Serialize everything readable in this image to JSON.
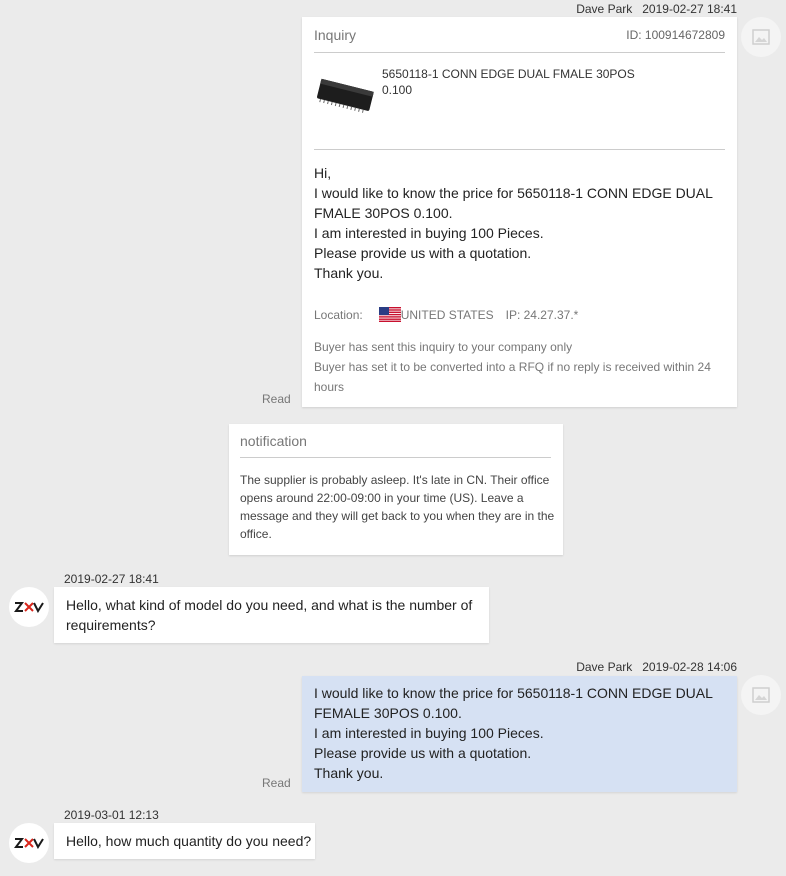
{
  "inquiry_msg": {
    "sender": "Dave Park",
    "time": "2019-02-27 18:41",
    "read": "Read",
    "title": "Inquiry",
    "id_text": "ID: 100914672809",
    "product_name_line1": "5650118-1 CONN EDGE DUAL FMALE 30POS",
    "product_name_line2": "0.100",
    "body_lines": [
      "Hi,",
      "I would like to know the price for 5650118-1 CONN EDGE DUAL",
      "FMALE 30POS 0.100.",
      "I am interested in buying 100 Pieces.",
      "Please provide us with a quotation.",
      "Thank you."
    ],
    "location_label": "Location:",
    "country": "UNITED STATES",
    "ip": "IP: 24.27.37.*",
    "notes": [
      "Buyer has sent this inquiry to your company only",
      "Buyer has set it to be converted into a RFQ if no reply is received within 24",
      "hours"
    ]
  },
  "notification": {
    "title": "notification",
    "lines": [
      "The supplier is probably asleep. It's late in CN. Their office",
      "opens around 22:00-09:00 in your time (US). Leave a",
      "message and they will get back to you when they are in the",
      "office."
    ]
  },
  "supplier_msg_1": {
    "time": "2019-02-27 18:41",
    "lines": [
      "Hello, what kind of model do you need, and what is the number of",
      "requirements?"
    ]
  },
  "buyer_msg_2": {
    "sender": "Dave Park",
    "time": "2019-02-28 14:06",
    "read": "Read",
    "lines": [
      "I would like to know the price for 5650118-1 CONN EDGE DUAL",
      "FEMALE 30POS 0.100.",
      "I am interested in buying 100 Pieces.",
      "Please provide us with a quotation.",
      "Thank you."
    ]
  },
  "supplier_msg_2": {
    "time": "2019-03-01 12:13",
    "lines": [
      "Hello, how much quantity do you need?"
    ]
  },
  "icons": {
    "buyer_avatar": "image-placeholder-icon",
    "supplier_logo": "zxv-logo",
    "flag": "us-flag-icon"
  },
  "colors": {
    "page_bg": "#ebebeb",
    "buyer_bubble": "#d6e1f3",
    "logo_red": "#d9261c"
  }
}
